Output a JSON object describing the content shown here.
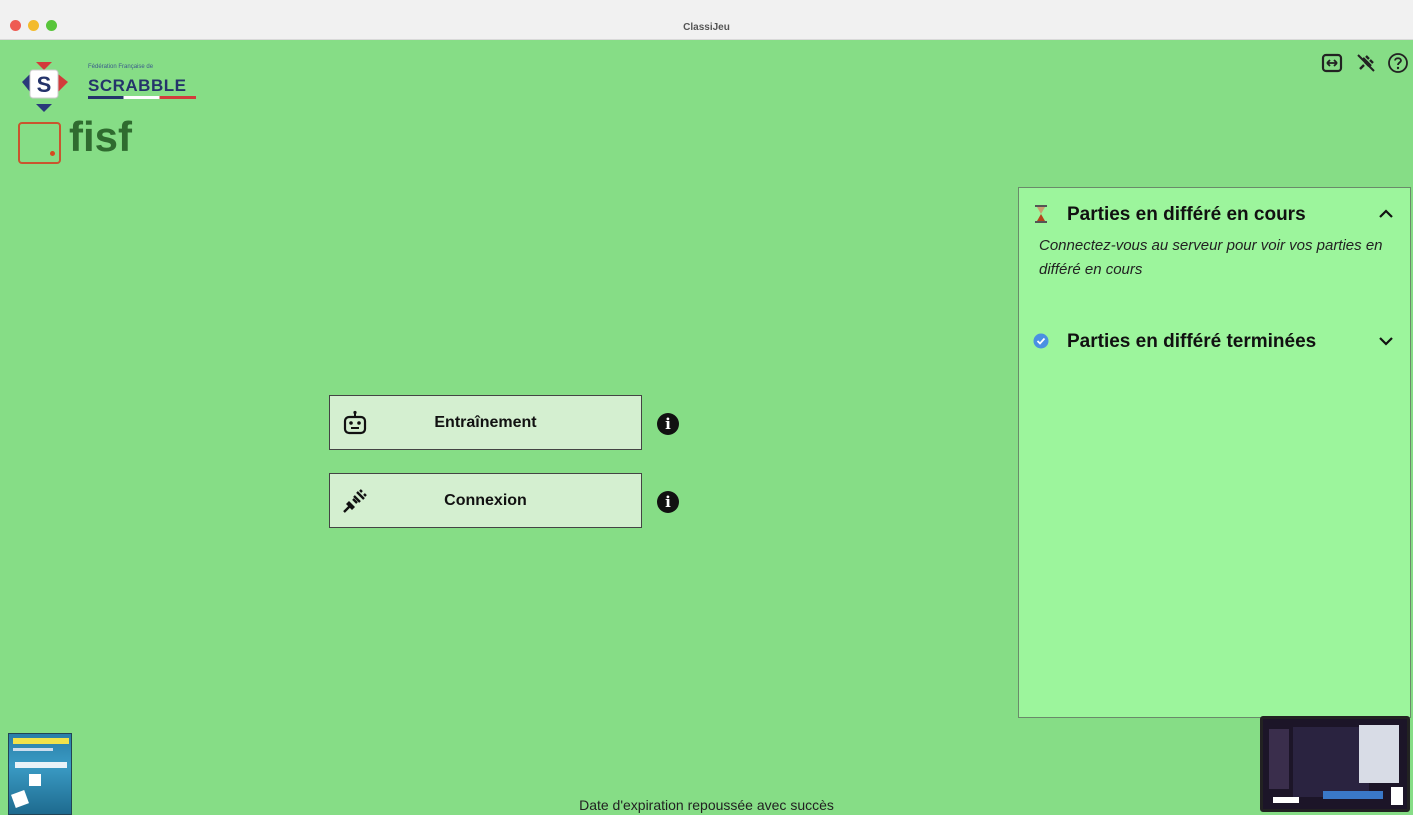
{
  "window": {
    "title": "ClassiJeu"
  },
  "logos": {
    "ffs_small": "Fédération Française de",
    "ffs_name": "SCRABBLE",
    "ffs_letter": "S",
    "fisf_name": "fisf"
  },
  "top_icons": [
    "exit-icon",
    "plugin-off-icon",
    "help-icon"
  ],
  "main": {
    "buttons": [
      {
        "label": "Entraînement",
        "icon": "robot-icon"
      },
      {
        "label": "Connexion",
        "icon": "plug-icon"
      }
    ],
    "info_symbol": "i"
  },
  "panel": {
    "section_active": {
      "title": "Parties en différé en cours",
      "icon": "hourglass-icon",
      "message": "Connectez-vous au serveur pour voir vos parties en différé en cours"
    },
    "section_finished": {
      "title": "Parties en différé terminées",
      "icon": "check-circle-icon"
    }
  },
  "status": {
    "message": "Date d'expiration repoussée avec succès"
  },
  "colors": {
    "background": "#86dd86",
    "panel": "#9cf59c",
    "button": "#d4efd0"
  }
}
